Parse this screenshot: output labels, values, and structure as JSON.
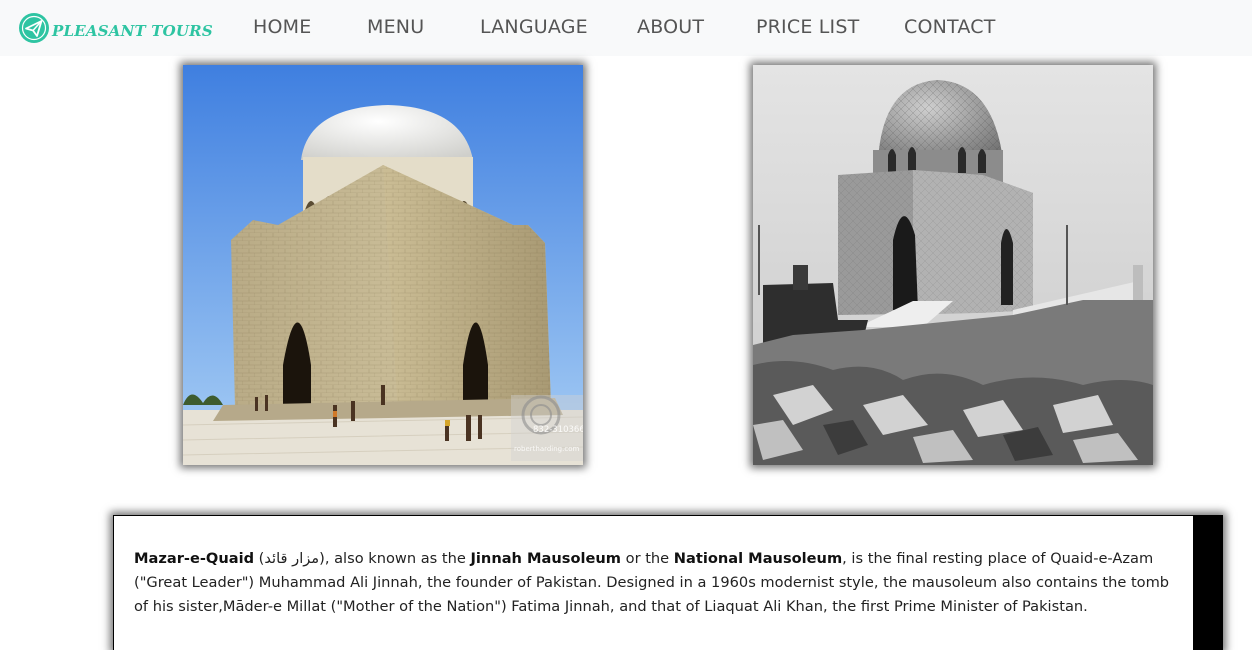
{
  "brand": {
    "name": "PLEASANT TOURS",
    "icon": "paper-plane-icon",
    "color": "#2ec4a2"
  },
  "nav": {
    "home": "HOME",
    "menu": "MENU",
    "language": "LANGUAGE",
    "about": "ABOUT",
    "price_list": "PRICE LIST",
    "contact": "CONTACT"
  },
  "photos": {
    "modern": {
      "watermark_number": "832-310366",
      "watermark_site": "robertharding.com"
    }
  },
  "info": {
    "title": "Mazar-e-Quaid",
    "native_name": "مزار قائد",
    "t1": " (",
    "t2": "), also known as the ",
    "name1": "Jinnah Mausoleum",
    "t3": " or the ",
    "name2": "National Mausoleum",
    "t4": ", is the final resting place of Quaid-e-Azam (\"Great Leader\") Muhammad Ali Jinnah, the founder of Pakistan. Designed in a 1960s modernist style, the mausoleum also contains the tomb of his sister,Māder-e Millat (\"Mother of the Nation\") Fatima Jinnah, and that of Liaquat Ali Khan, the first Prime Minister of Pakistan."
  }
}
